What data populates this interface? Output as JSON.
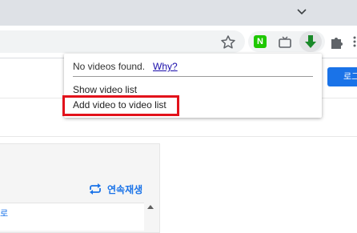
{
  "toolbar": {
    "extensions": {
      "naver_label": "N"
    }
  },
  "page": {
    "login_button_label": "로그",
    "autoplay_label": "연속재생",
    "cut_text": "로"
  },
  "popup": {
    "no_videos_text": "No videos found.",
    "why_link": "Why?",
    "show_list_label": "Show video list",
    "add_video_label": "Add video to video list"
  },
  "colors": {
    "accent": "#1a73e8",
    "highlight": "#e2121b",
    "download_icon": "#1b8a2a",
    "naver": "#1ec800"
  }
}
